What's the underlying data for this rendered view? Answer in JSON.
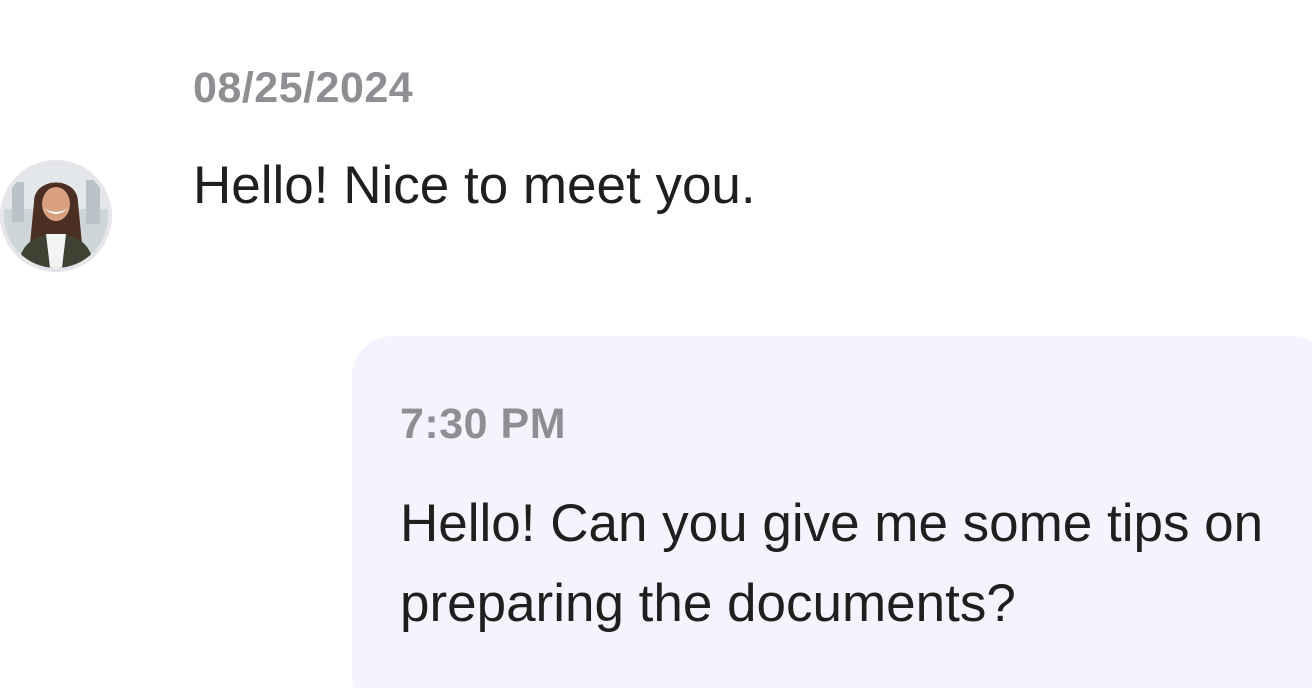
{
  "conversation": {
    "incoming": {
      "date": "08/25/2024",
      "message": "Hello! Nice to meet you.",
      "avatar_icon": "user-avatar-photo"
    },
    "outgoing": {
      "time": "7:30 PM",
      "message": "Hello! Can you give me some tips on preparing the documents?",
      "bubble_color": "#f4f3fe"
    }
  }
}
